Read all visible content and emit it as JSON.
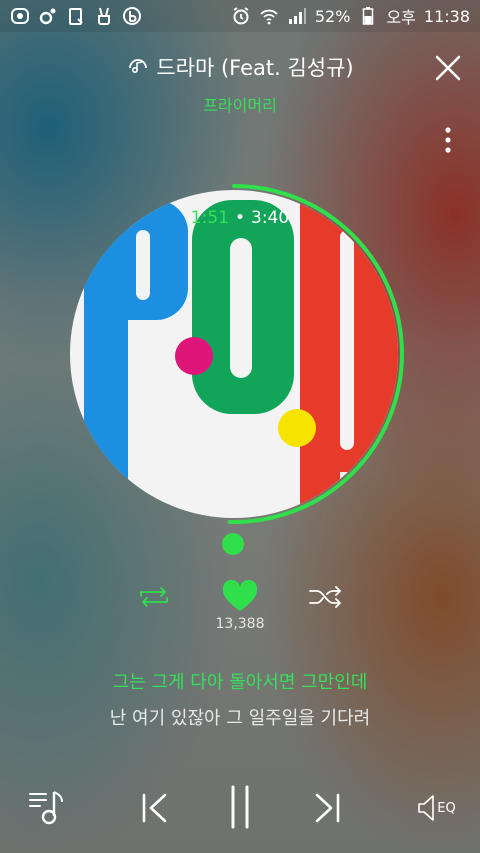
{
  "status_bar": {
    "battery_percent": "52%",
    "ampm": "오후",
    "time": "11:38",
    "left_icons": [
      "app-icon-1",
      "music-app-icon",
      "clipboard-icon",
      "victory-hand-icon",
      "b-app-icon"
    ],
    "right_icons": [
      "alarm-icon",
      "wifi-icon",
      "signal-icon",
      "battery-icon"
    ]
  },
  "header": {
    "title": "드라마 (Feat. 김성규)",
    "artist": "프라이머리",
    "title_icon": "headphone-music-icon"
  },
  "player": {
    "elapsed": "1:51",
    "separator": "•",
    "total": "3:40",
    "progress_fraction": 0.504,
    "like_count": "13,388",
    "repeat_icon": "repeat-icon",
    "like_icon": "heart-icon",
    "shuffle_icon": "shuffle-icon"
  },
  "album_art": {
    "letters": [
      "P",
      "O",
      "P"
    ],
    "colors": {
      "blue": "#1c8fe0",
      "green": "#12a55a",
      "red": "#e63a2a",
      "pink": "#e0157a",
      "yellow": "#f6e400"
    }
  },
  "lyrics": {
    "current": "그는 그게 다아 돌아서면 그만인데",
    "next": "난 여기 있잖아 그 일주일을 기다려"
  },
  "bottom_bar": {
    "playlist_icon": "playlist-icon",
    "prev_icon": "previous-icon",
    "pause_icon": "pause-icon",
    "next_icon": "next-icon",
    "eq_label": "EQ"
  },
  "accent": "#2fe04b"
}
